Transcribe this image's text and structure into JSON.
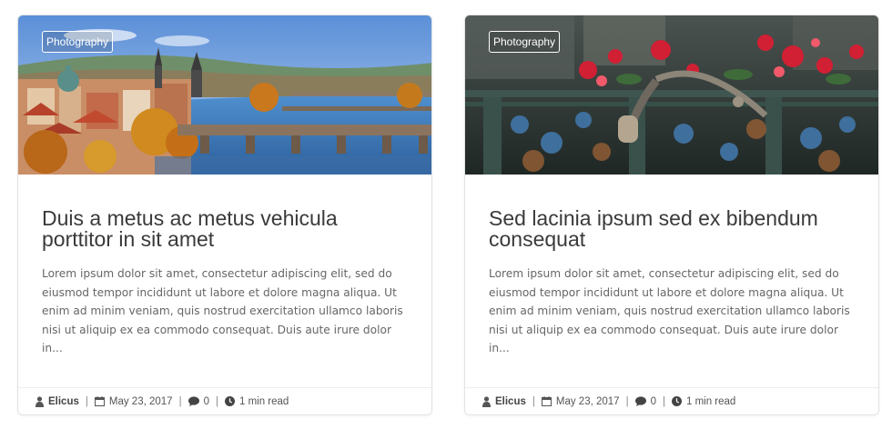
{
  "posts": [
    {
      "category": "Photography",
      "title": "Duis a metus ac metus vehicula porttitor in sit amet",
      "excerpt": "Lorem ipsum dolor sit amet, consectetur adipiscing elit, sed do eiusmod tempor incididunt ut labore et dolore magna aliqua. Ut enim ad minim veniam, quis nostrud exercitation ullamco laboris nisi ut aliquip ex ea commodo consequat. Duis aute irure dolor in...",
      "author": "Elicus",
      "date": "May 23, 2017",
      "comments": "0",
      "read_time": "1 min read"
    },
    {
      "category": "Photography",
      "title": "Sed lacinia ipsum sed ex bibendum consequat",
      "excerpt": "Lorem ipsum dolor sit amet, consectetur adipiscing elit, sed do eiusmod tempor incididunt ut labore et dolore magna aliqua. Ut enim ad minim veniam, quis nostrud exercitation ullamco laboris nisi ut aliquip ex ea commodo consequat. Duis aute irure dolor in...",
      "author": "Elicus",
      "date": "May 23, 2017",
      "comments": "0",
      "read_time": "1 min read"
    }
  ],
  "colors": {
    "title": "#3a3a3a",
    "text": "#666666",
    "border": "#e3e3e3"
  }
}
